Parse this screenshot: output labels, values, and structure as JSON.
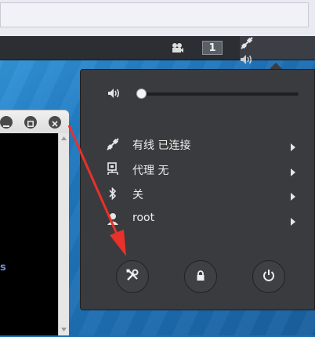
{
  "panel": {
    "workspace_number": "1",
    "icons": [
      "camera-icon",
      "network-wired-icon",
      "volume-icon",
      "power-icon",
      "dropdown-arrow-icon"
    ]
  },
  "status_menu": {
    "volume": {
      "icon": "volume-icon",
      "level": 0.0
    },
    "items": [
      {
        "icon": "network-wired-icon",
        "label": "有线 已连接"
      },
      {
        "icon": "proxy-icon",
        "label": "代理 无"
      },
      {
        "icon": "bluetooth-icon",
        "label": "关"
      },
      {
        "icon": "user-icon",
        "label": "root"
      }
    ],
    "buttons": [
      {
        "icon": "settings-tools-icon"
      },
      {
        "icon": "lock-icon"
      },
      {
        "icon": "power-icon"
      }
    ]
  },
  "terminal": {
    "visible_text": "s"
  },
  "colors": {
    "panel_bg": "#2b2e32",
    "menu_bg": "#393b3e",
    "desktop_bg": "#1d6fb3",
    "annotation_arrow": "#e8312a"
  }
}
